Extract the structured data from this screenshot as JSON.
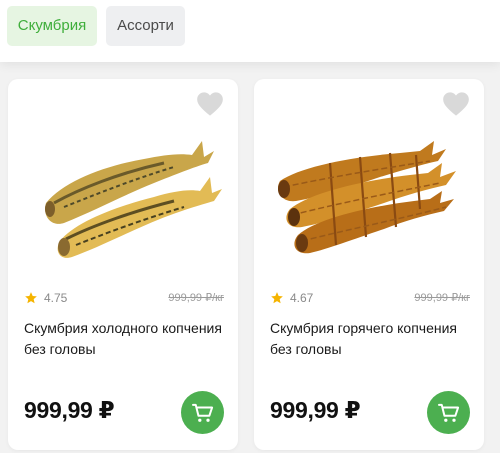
{
  "filters": [
    {
      "label": "Скумбрия",
      "active": true
    },
    {
      "label": "Ассорти",
      "active": false
    }
  ],
  "products": [
    {
      "title": "Скумбрия холодного копчения без головы",
      "rating": "4.75",
      "unit_price": "999,99 ₽/кг",
      "price": "999,99 ₽",
      "favorite_icon": "heart-icon",
      "cart_icon": "cart-icon"
    },
    {
      "title": "Скумбрия горячего копчения без головы",
      "rating": "4.67",
      "unit_price": "999,99 ₽/кг",
      "price": "999,99 ₽",
      "favorite_icon": "heart-icon",
      "cart_icon": "cart-icon"
    }
  ],
  "colors": {
    "accent": "#4caf50",
    "chip_active_bg": "#e6f5e2",
    "chip_active_text": "#3fae3b",
    "star": "#f5b400"
  }
}
